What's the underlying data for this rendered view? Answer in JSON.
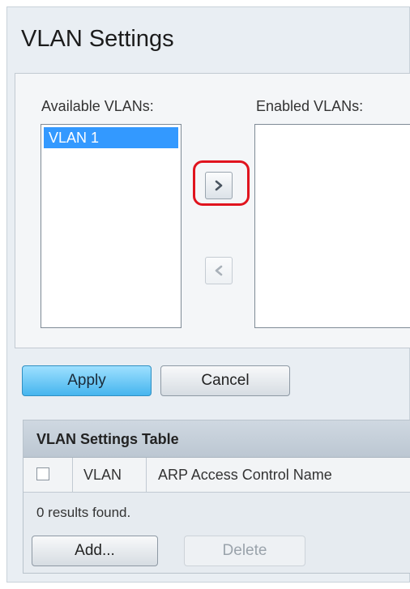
{
  "page": {
    "title": "VLAN Settings"
  },
  "vlan_selector": {
    "available_label": "Available VLANs:",
    "enabled_label": "Enabled VLANs:",
    "available_items": [
      "VLAN 1"
    ],
    "enabled_items": [],
    "add_arrow": ">",
    "remove_arrow": "<",
    "highlight_color": "#e0141e"
  },
  "actions": {
    "apply_label": "Apply",
    "cancel_label": "Cancel"
  },
  "table": {
    "title": "VLAN Settings Table",
    "columns": [
      "VLAN",
      "ARP Access Control Name"
    ],
    "empty_message": "0 results found.",
    "add_label": "Add...",
    "delete_label": "Delete"
  },
  "colors": {
    "accent": "#46b5ee",
    "selection": "#3399ff"
  }
}
